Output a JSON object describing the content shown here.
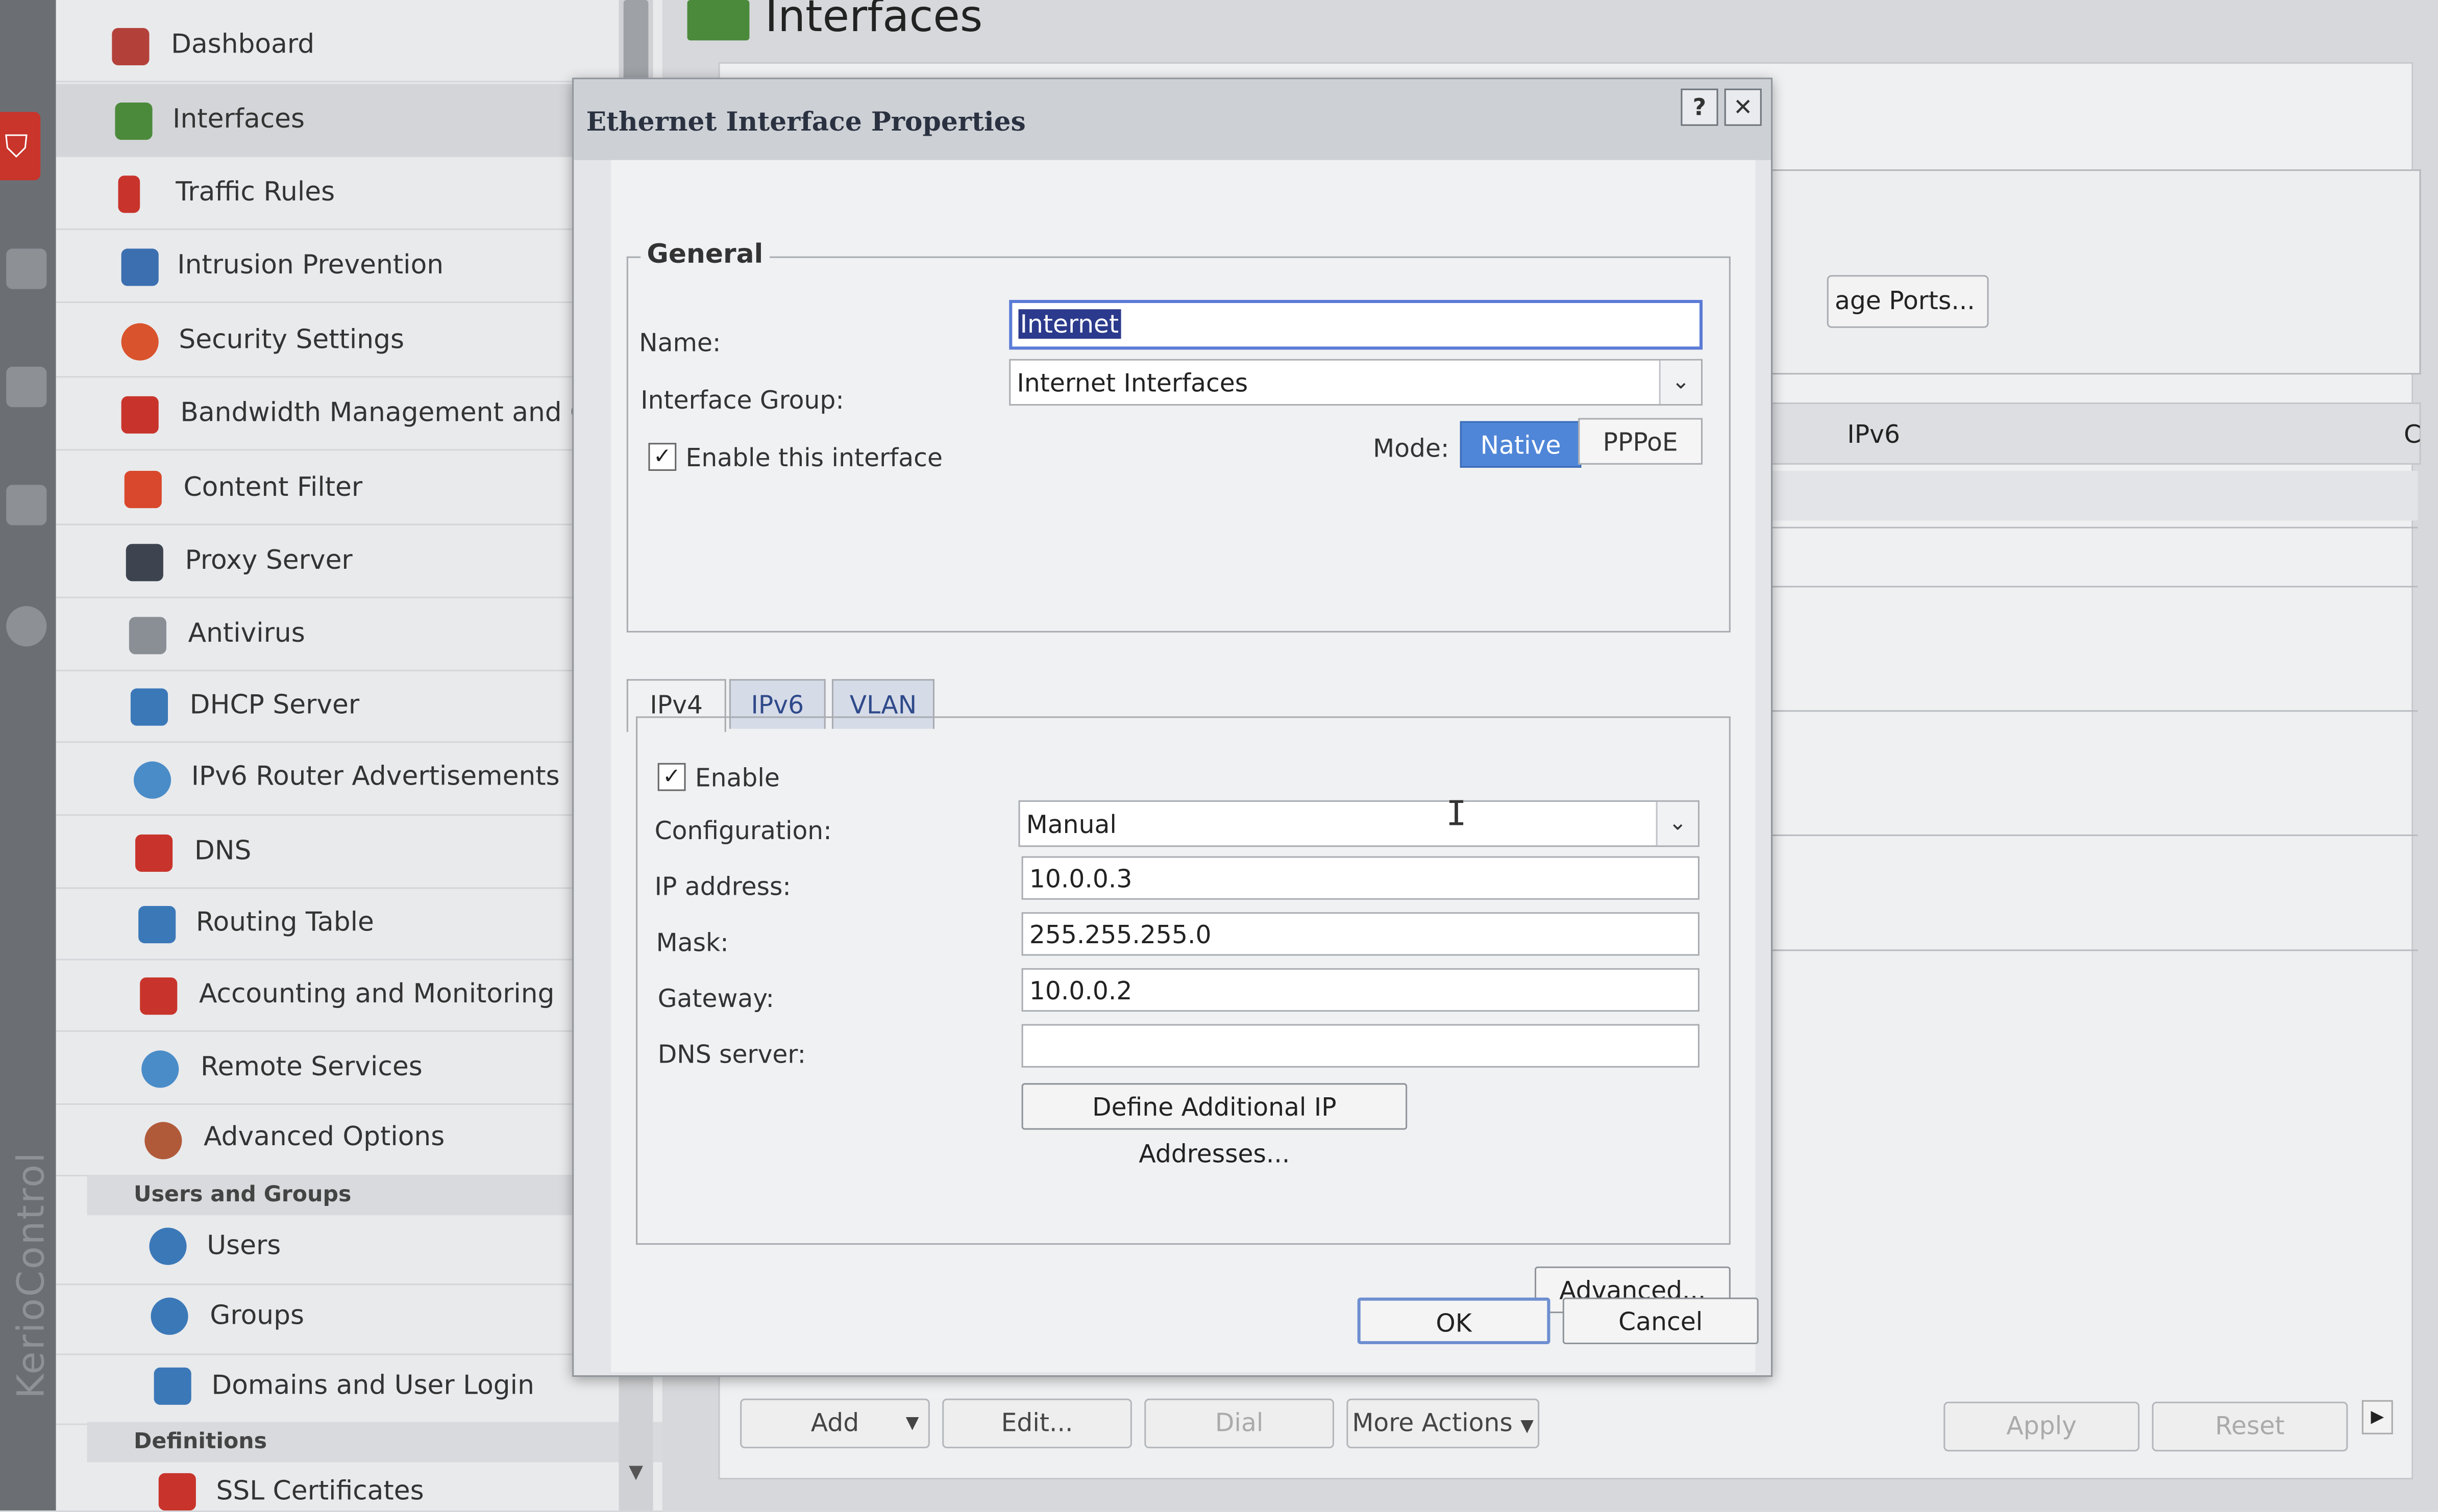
{
  "sidebar": {
    "items": [
      {
        "label": "Dashboard",
        "icon": "dashboard-icon",
        "color": "#b3413a"
      },
      {
        "label": "Interfaces",
        "icon": "network-card-icon",
        "color": "#4b8a3b"
      },
      {
        "label": "Traffic Rules",
        "icon": "traffic-light-icon",
        "color": "#c8342b"
      },
      {
        "label": "Intrusion Prevention",
        "icon": "shield-icon",
        "color": "#3b6fb0"
      },
      {
        "label": "Security Settings",
        "icon": "hand-stop-icon",
        "color": "#d9532c"
      },
      {
        "label": "Bandwidth Management and Q",
        "icon": "bandwidth-icon",
        "color": "#c8342b"
      },
      {
        "label": "Content Filter",
        "icon": "funnel-icon",
        "color": "#d9482c"
      },
      {
        "label": "Proxy Server",
        "icon": "proxy-icon",
        "color": "#3d4450"
      },
      {
        "label": "Antivirus",
        "icon": "syringe-icon",
        "color": "#8a8f96"
      },
      {
        "label": "DHCP Server",
        "icon": "monitor-icon",
        "color": "#3b78b8"
      },
      {
        "label": "IPv6 Router Advertisements",
        "icon": "ipv6-icon",
        "color": "#4a8cc8"
      },
      {
        "label": "DNS",
        "icon": "dns-tree-icon",
        "color": "#c8342b"
      },
      {
        "label": "Routing Table",
        "icon": "routing-icon",
        "color": "#3b78b8"
      },
      {
        "label": "Accounting and Monitoring",
        "icon": "accounting-icon",
        "color": "#c8342b"
      },
      {
        "label": "Remote Services",
        "icon": "cloud-icon",
        "color": "#4a8cc8"
      },
      {
        "label": "Advanced Options",
        "icon": "gear-icon",
        "color": "#b05a3a"
      }
    ],
    "section_users": "Users and Groups",
    "user_items": [
      {
        "label": "Users",
        "icon": "user-icon",
        "color": "#3b78b8"
      },
      {
        "label": "Groups",
        "icon": "group-icon",
        "color": "#3b78b8"
      },
      {
        "label": "Domains and User Login",
        "icon": "domain-login-icon",
        "color": "#3b78b8"
      }
    ],
    "section_definitions": "Definitions",
    "def_items": [
      {
        "label": "SSL Certificates",
        "icon": "certificate-icon",
        "color": "#c8342b"
      }
    ],
    "brand": "KerioControl"
  },
  "main": {
    "title": "Interfaces",
    "manage_ports": "age Ports...",
    "col_ipv6": "IPv6",
    "col_cut": "C",
    "buttons": {
      "add": "Add",
      "edit": "Edit...",
      "dial": "Dial",
      "more_actions": "More Actions",
      "apply": "Apply",
      "reset": "Reset"
    }
  },
  "dialog": {
    "title": "Ethernet Interface Properties",
    "help": "?",
    "close": "✕",
    "general": {
      "legend": "General",
      "name_label": "Name:",
      "name_value": "Internet",
      "group_label": "Interface Group:",
      "group_value": "Internet Interfaces",
      "enable_label": "Enable this interface",
      "mode_label": "Mode:",
      "mode_native": "Native",
      "mode_pppoe": "PPPoE"
    },
    "tabs": [
      "IPv4",
      "IPv6",
      "VLAN"
    ],
    "ipv4": {
      "enable_label": "Enable",
      "config_label": "Configuration:",
      "config_value": "Manual",
      "ip_label": "IP address:",
      "ip_value": "10.0.0.3",
      "mask_label": "Mask:",
      "mask_value": "255.255.255.0",
      "gateway_label": "Gateway:",
      "gateway_value": "10.0.0.2",
      "dns_label": "DNS server:",
      "dns_value": "",
      "define_button": "Define Additional IP Addresses..."
    },
    "advanced_button": "Advanced...",
    "ok_button": "OK",
    "cancel_button": "Cancel"
  }
}
